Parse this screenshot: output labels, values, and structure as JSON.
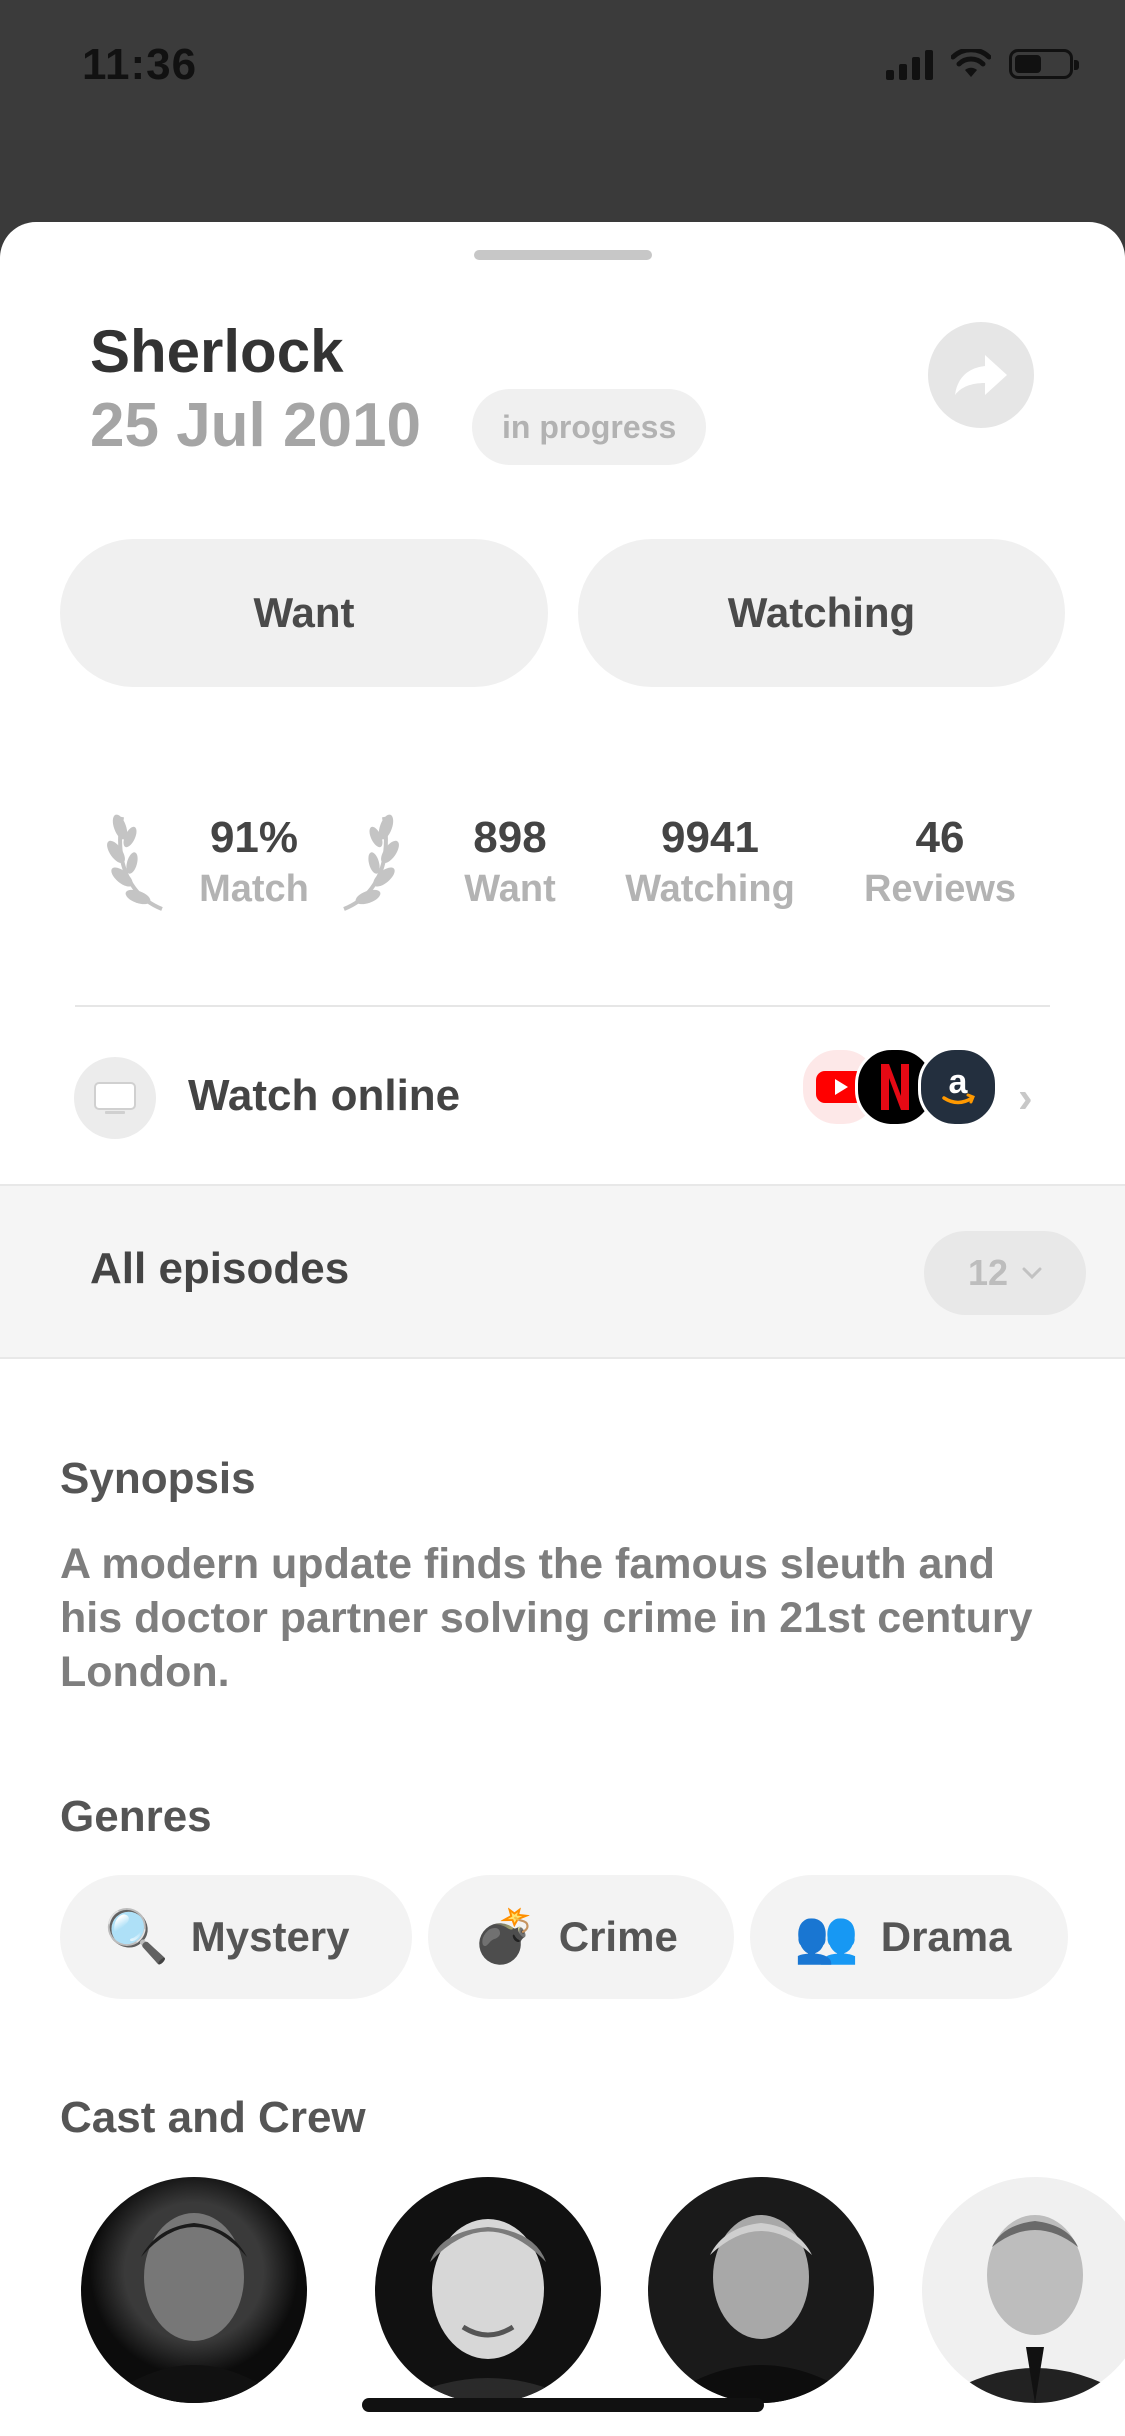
{
  "status_bar": {
    "time": "11:36",
    "icons": [
      "cellular-signal-icon",
      "wifi-icon",
      "battery-icon"
    ]
  },
  "show": {
    "title": "Sherlock",
    "date": "25 Jul 2010",
    "status": "in progress"
  },
  "actions": {
    "want": "Want",
    "watching": "Watching",
    "share_icon": "share-arrow-icon"
  },
  "stats": [
    {
      "value": "91%",
      "label": "Match"
    },
    {
      "value": "898",
      "label": "Want"
    },
    {
      "value": "9941",
      "label": "Watching"
    },
    {
      "value": "46",
      "label": "Reviews"
    }
  ],
  "watch_online": {
    "label": "Watch online",
    "providers": [
      "youtube-icon",
      "netflix-icon",
      "amazon-icon"
    ]
  },
  "episodes": {
    "label": "All episodes",
    "count": "12"
  },
  "synopsis": {
    "title": "Synopsis",
    "text": "A modern update finds the famous sleuth and his doctor partner solving crime in 21st century London."
  },
  "genres": {
    "title": "Genres",
    "items": [
      {
        "emoji": "🔍",
        "label": "Mystery"
      },
      {
        "emoji": "💣",
        "label": "Crime"
      },
      {
        "emoji": "👥",
        "label": "Drama"
      }
    ]
  },
  "cast": {
    "title": "Cast and Crew"
  },
  "colors": {
    "background_dim": "#3a3a3a",
    "sheet": "#ffffff",
    "pill": "#f0f0f0",
    "muted_text": "#a5a5a5",
    "youtube_red": "#ff0000",
    "netflix_red": "#e50914",
    "amazon_dark": "#232f3e"
  }
}
